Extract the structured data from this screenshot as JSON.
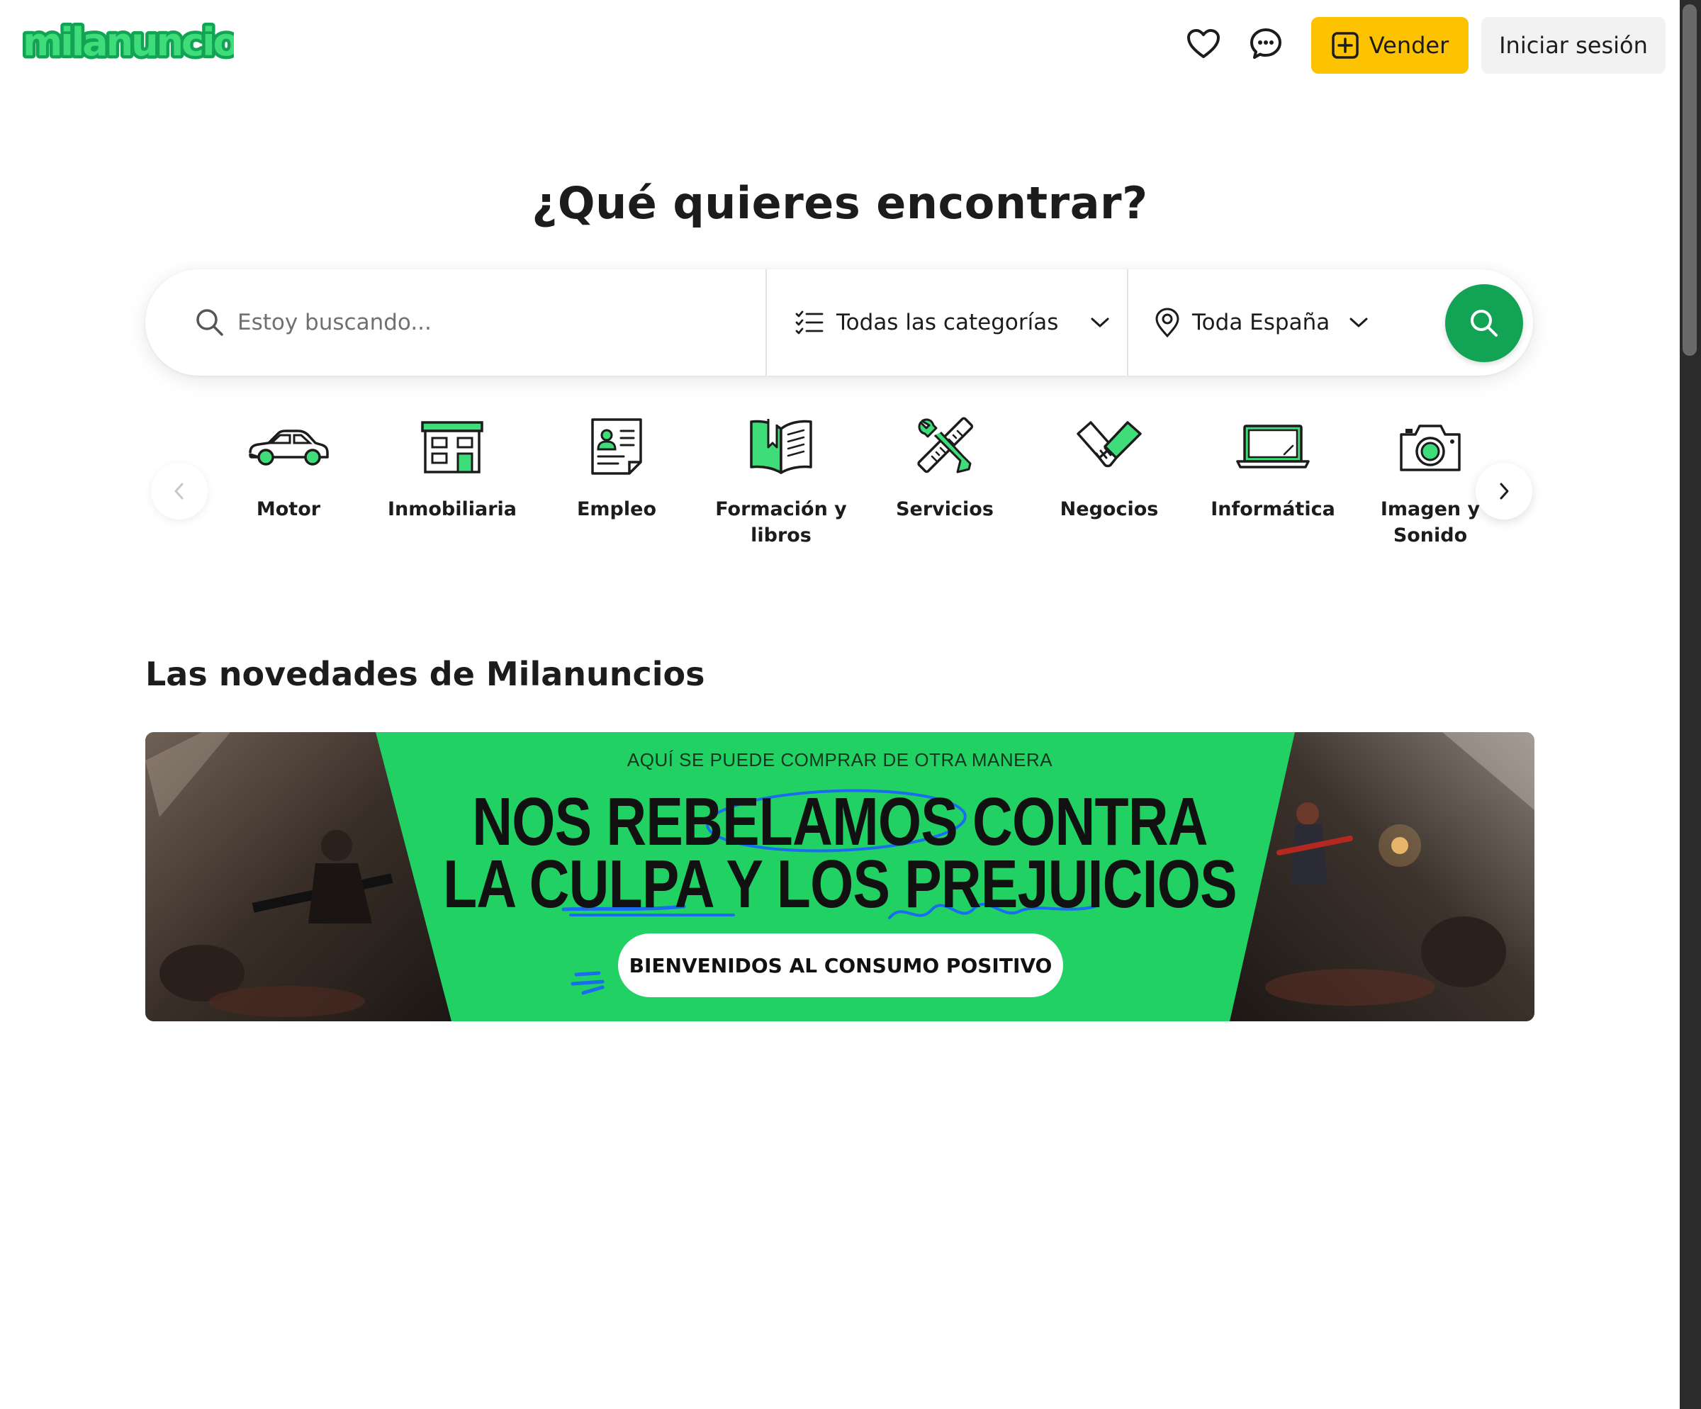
{
  "header": {
    "logo_text": "milanuncios",
    "favorites_icon": "heart-icon",
    "messages_icon": "chat-icon",
    "sell_label": "Vender",
    "login_label": "Iniciar sesión"
  },
  "hero": {
    "title": "¿Qué quieres encontrar?"
  },
  "search": {
    "placeholder": "Estoy buscando...",
    "value": "",
    "category": "Todas las categorías",
    "location": "Toda España"
  },
  "categories": [
    {
      "label": "Motor",
      "icon": "car-icon"
    },
    {
      "label": "Inmobiliaria",
      "icon": "building-icon"
    },
    {
      "label": "Empleo",
      "icon": "resume-icon"
    },
    {
      "label": "Formación y libros",
      "icon": "book-icon"
    },
    {
      "label": "Servicios",
      "icon": "tools-icon"
    },
    {
      "label": "Negocios",
      "icon": "handshake-icon"
    },
    {
      "label": "Informática",
      "icon": "laptop-icon"
    },
    {
      "label": "Imagen y Sonido",
      "icon": "camera-icon"
    }
  ],
  "novedades": {
    "title": "Las novedades de Milanuncios",
    "banner": {
      "kicker": "AQUÍ SE PUEDE COMPRAR DE OTRA MANERA",
      "line1": "NOS REBELAMOS CONTRA",
      "line2": "LA CULPA Y LOS PREJUICIOS",
      "cta": "BIENVENIDOS AL CONSUMO POSITIVO"
    }
  },
  "colors": {
    "brand_green": "#12a454",
    "sell_yellow": "#fdc200",
    "banner_green": "#21d164",
    "accent_blue": "#1a6cf0"
  }
}
